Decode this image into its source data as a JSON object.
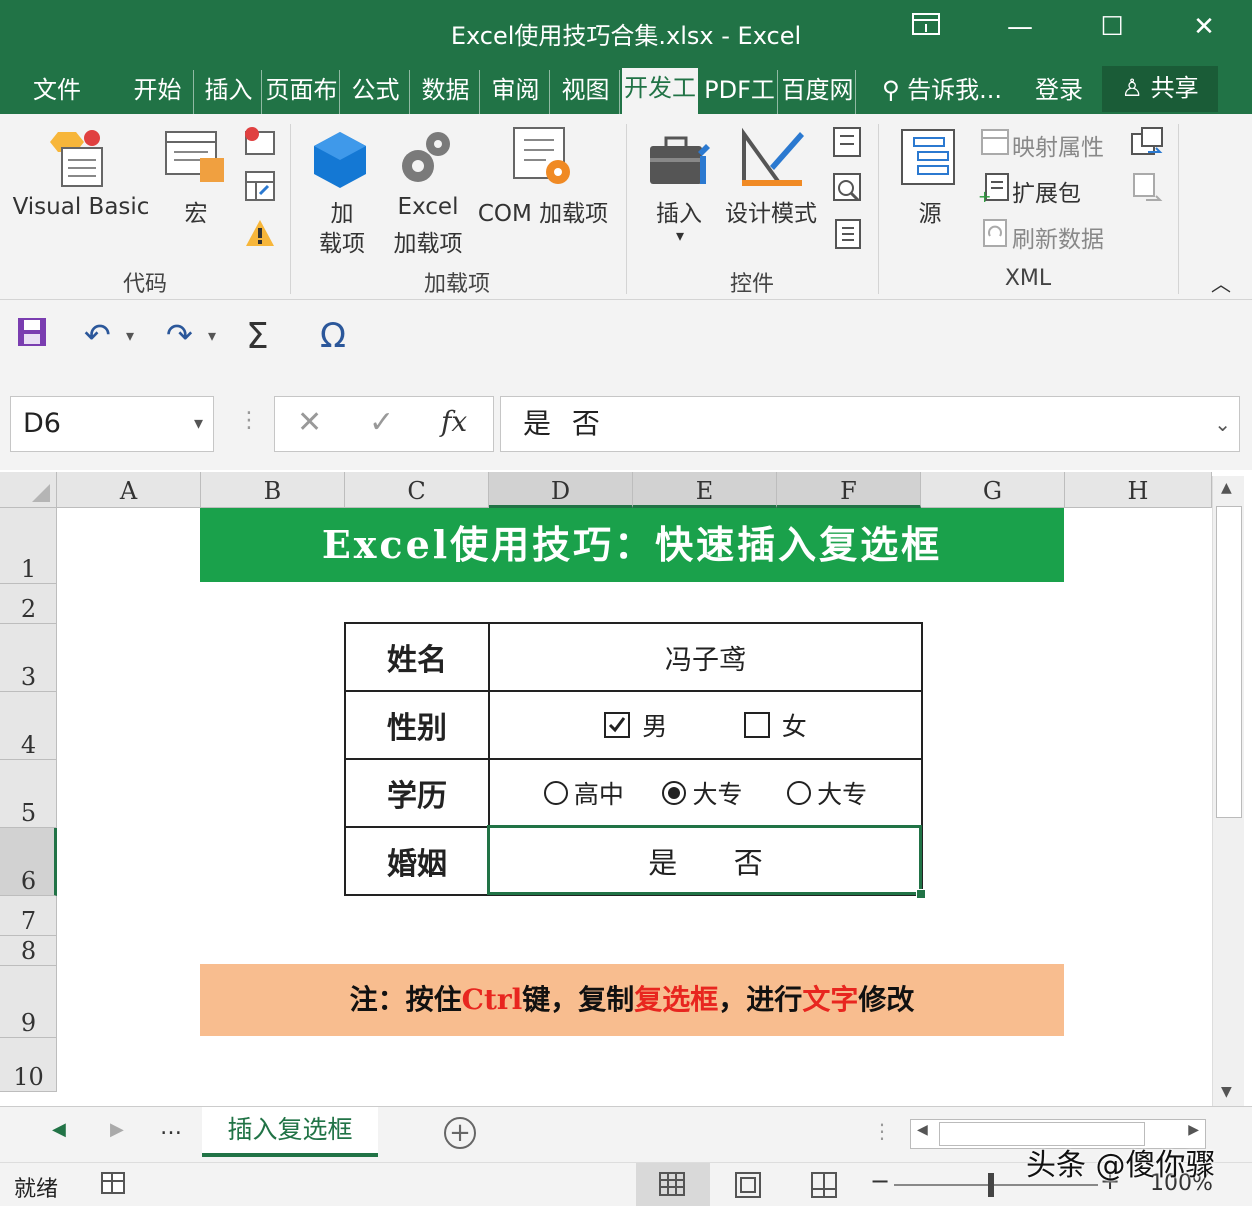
{
  "window": {
    "title": "Excel使用技巧合集.xlsx - Excel"
  },
  "tabs": [
    "文件",
    "开始",
    "插入",
    "页面布",
    "公式",
    "数据",
    "审阅",
    "视图",
    "开发工",
    "PDF工",
    "百度网"
  ],
  "active_tab": "开发工",
  "tell_me": "告诉我...",
  "login": "登录",
  "share": "共享",
  "ribbon": {
    "code": {
      "visual_basic": "Visual Basic",
      "macro": "宏",
      "group": "代码"
    },
    "addins": {
      "addin_1": "加",
      "addin_2": "载项",
      "excel_addin_1": "Excel",
      "excel_addin_2": "加载项",
      "com_addin": "COM 加载项",
      "group": "加载项"
    },
    "controls": {
      "insert": "插入",
      "design_mode": "设计模式",
      "group": "控件"
    },
    "xml": {
      "source": "源",
      "map_properties": "映射属性",
      "expansion_packs": "扩展包",
      "refresh_data": "刷新数据",
      "group": "XML"
    }
  },
  "namebox": "D6",
  "formula": "是 否",
  "columns": [
    "A",
    "B",
    "C",
    "D",
    "E",
    "F",
    "G",
    "H"
  ],
  "rows": [
    "1",
    "2",
    "3",
    "4",
    "5",
    "6",
    "7",
    "8",
    "9",
    "10"
  ],
  "sheet": {
    "banner": "Excel使用技巧：快速插入复选框",
    "form": {
      "name_label": "姓名",
      "name_value": "冯子鸢",
      "gender_label": "性别",
      "gender_opt1": "男",
      "gender_opt2": "女",
      "edu_label": "学历",
      "edu_opt1": "高中",
      "edu_opt2": "大专",
      "edu_opt3": "大专",
      "marriage_label": "婚姻",
      "marriage_opt1": "是",
      "marriage_opt2": "否"
    },
    "note": {
      "p1": "注：按住",
      "p2": "Ctrl",
      "p3": "键，复制",
      "p4": "复选框",
      "p5": "，进行",
      "p6": "文字",
      "p7": "修改"
    }
  },
  "sheet_tab": "插入复选框",
  "status": {
    "ready": "就绪",
    "zoom": "100%"
  },
  "watermark": "头条 @傻你骤",
  "colors": {
    "excel_green": "#217346",
    "banner_green": "#1aa14b",
    "note_orange": "#f8bd8f",
    "note_red": "#e8261f"
  }
}
